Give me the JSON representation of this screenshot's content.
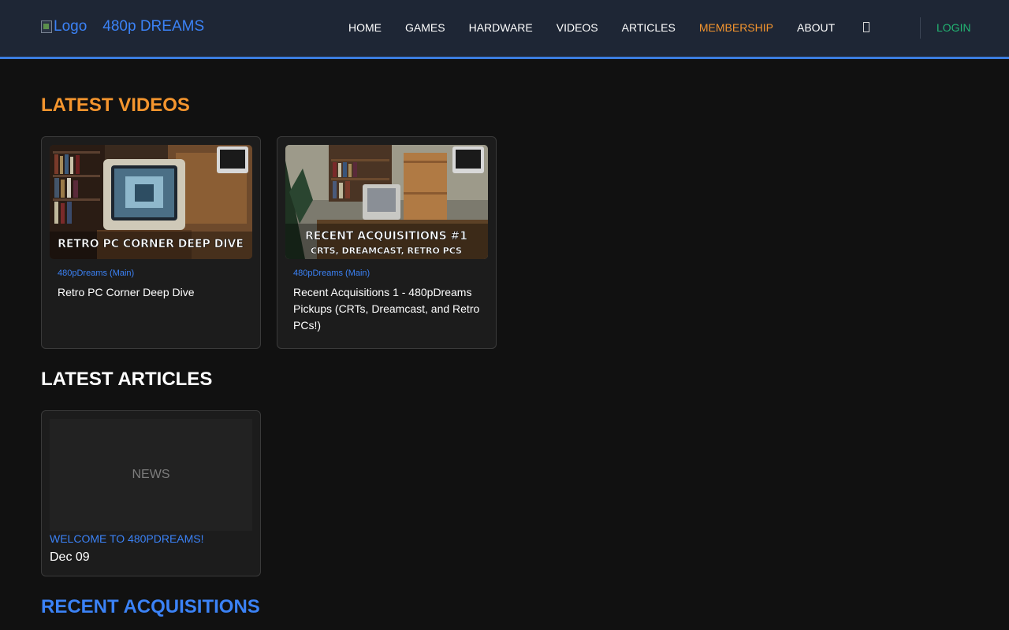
{
  "header": {
    "logo_alt": "Logo",
    "site_name": "480p DREAMS",
    "nav": [
      {
        "label": "HOME"
      },
      {
        "label": "GAMES"
      },
      {
        "label": "HARDWARE"
      },
      {
        "label": "VIDEOS"
      },
      {
        "label": "ARTICLES"
      },
      {
        "label": "MEMBERSHIP",
        "active": true
      },
      {
        "label": "ABOUT"
      }
    ],
    "search_icon": "search-icon",
    "login_label": "LOGIN"
  },
  "colors": {
    "accent_orange": "#f4952e",
    "accent_blue": "#3b82f6",
    "login_green": "#22b573",
    "header_bg": "#1e2635",
    "page_bg": "#111111"
  },
  "sections": {
    "latest_videos": {
      "title": "LATEST VIDEOS",
      "videos": [
        {
          "thumb_caption": "RETRO PC CORNER DEEP DIVE",
          "channel": "480pDreams (Main)",
          "title": "Retro PC Corner Deep Dive"
        },
        {
          "thumb_caption_line1": "RECENT ACQUISITIONS #1",
          "thumb_caption_line2": "CRTS, DREAMCAST, RETRO PCS",
          "channel": "480pDreams (Main)",
          "title": "Recent Acquisitions 1 - 480pDreams Pickups (CRTs, Dreamcast, and Retro PCs!)"
        }
      ]
    },
    "latest_articles": {
      "title": "LATEST ARTICLES",
      "articles": [
        {
          "placeholder": "NEWS",
          "title": "WELCOME TO 480PDREAMS!",
          "date": "Dec 09"
        }
      ]
    },
    "recent_acquisitions": {
      "title": "RECENT ACQUISITIONS"
    }
  }
}
